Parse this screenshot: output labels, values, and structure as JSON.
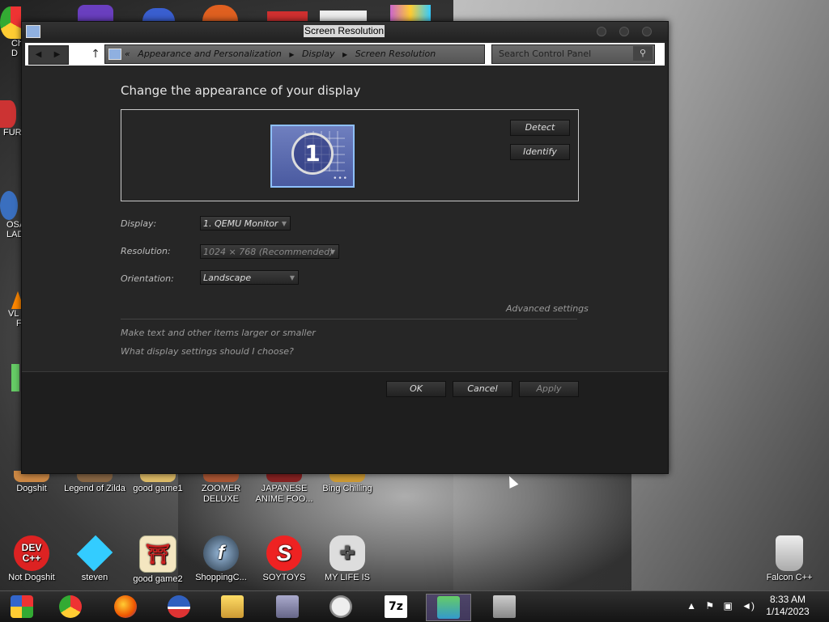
{
  "window": {
    "title": "Screen Resolution",
    "breadcrumb": {
      "prefix": "«",
      "items": [
        "Appearance and Personalization",
        "Display",
        "Screen Resolution"
      ],
      "separator": "▶"
    },
    "search_placeholder": "Search Control Panel",
    "icons": {
      "back": "back-arrow-icon",
      "forward": "forward-arrow-icon",
      "up": "up-arrow-icon",
      "refresh": "refresh-icon",
      "search": "magnifier-icon"
    }
  },
  "main": {
    "heading": "Change the appearance of your display",
    "monitor_number": "1",
    "detect_label": "Detect",
    "identify_label": "Identify",
    "display_label": "Display:",
    "display_value": "1. QEMU Monitor",
    "resolution_label": "Resolution:",
    "resolution_value": "1024 × 768 (Recommended)",
    "orientation_label": "Orientation:",
    "orientation_value": "Landscape",
    "advanced_link": "Advanced settings",
    "link_text_size": "Make text and other items larger or smaller",
    "link_help": "What display settings should I choose?"
  },
  "buttons": {
    "ok": "OK",
    "cancel": "Cancel",
    "apply": "Apply"
  },
  "desktop": {
    "partial_labels": [
      "Ch",
      "D",
      "FUR",
      "OSA",
      "LAD",
      "VL",
      "F"
    ],
    "row1": [
      "Dogshit",
      "Legend of Zilda",
      "good game1",
      "ZOOMER DELUXE",
      "JAPANESE ANIME FOO...",
      "Bing Chilling"
    ],
    "row2": [
      "Not Dogshit",
      "steven",
      "good game2",
      "ShoppingC...",
      "SOYTOYS",
      "MY LIFE IS"
    ],
    "recycle": "Falcon C++",
    "dev_icon_text": "DEV C++"
  },
  "taskbar": {
    "time": "8:33 AM",
    "date": "1/14/2023",
    "apps": [
      "start-orb-icon",
      "chrome-icon",
      "firefox-icon",
      "obama-icon",
      "file-explorer-icon",
      "setup-icon",
      "clock-icon",
      "7zip-icon",
      "control-panel-icon",
      "cabinet-icon"
    ],
    "sevenzip_text": "7z",
    "tray_glyphs": {
      "chevron": "▲",
      "flag": "⚑",
      "network": "▣",
      "volume": "◄)"
    }
  },
  "colors": {
    "window_bg": "#262626",
    "text_primary": "#e6e6e6",
    "text_muted": "#9a9a9a",
    "monitor_border": "#8ec0ff"
  }
}
